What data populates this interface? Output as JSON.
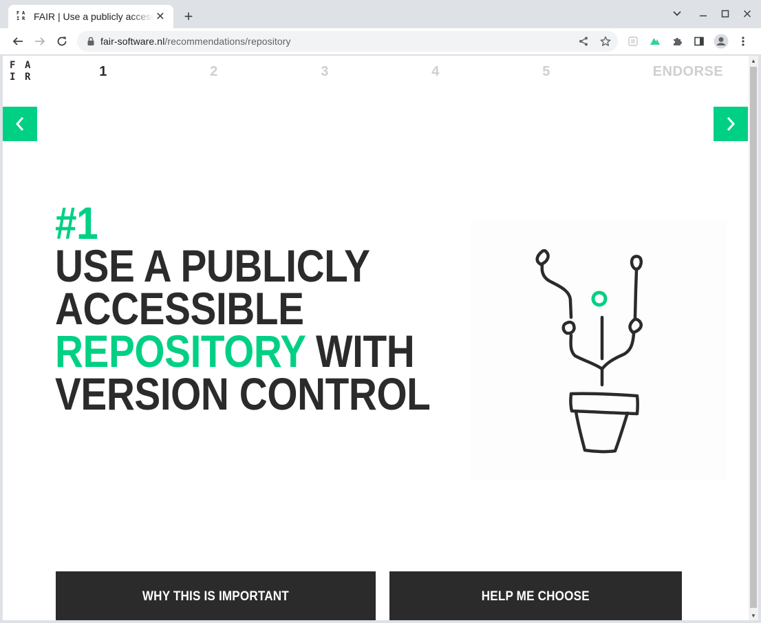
{
  "browser": {
    "tab_title": "FAIR | Use a publicly accessible repository",
    "favicon_letters": [
      "F",
      "A",
      "I",
      "R"
    ],
    "url_host": "fair-software.nl",
    "url_path": "/recommendations/repository"
  },
  "page": {
    "logo_letters": [
      "F",
      "A",
      "I",
      "R"
    ],
    "steps": [
      "1",
      "2",
      "3",
      "4",
      "5",
      "ENDORSE"
    ],
    "active_step": "1",
    "heading": {
      "number": "#1",
      "line1": "USE A PUBLICLY",
      "line2": "ACCESSIBLE",
      "line3_highlight": "REPOSITORY",
      "line3_rest": " WITH",
      "line4": "VERSION CONTROL"
    },
    "buttons": {
      "important": "WHY THIS IS IMPORTANT",
      "choose": "HELP ME CHOOSE"
    }
  },
  "colors": {
    "accent": "#00d084",
    "dark": "#2b2b2b",
    "inactive_step": "#cfcfcf"
  },
  "icons": [
    "back-arrow-icon",
    "forward-arrow-icon",
    "reload-icon",
    "lock-icon",
    "share-icon",
    "star-icon",
    "extension-icon",
    "puzzle-icon",
    "sidebar-icon",
    "profile-icon",
    "menu-icon",
    "chevron-left-icon",
    "chevron-right-icon",
    "plant-pot-illustration"
  ]
}
